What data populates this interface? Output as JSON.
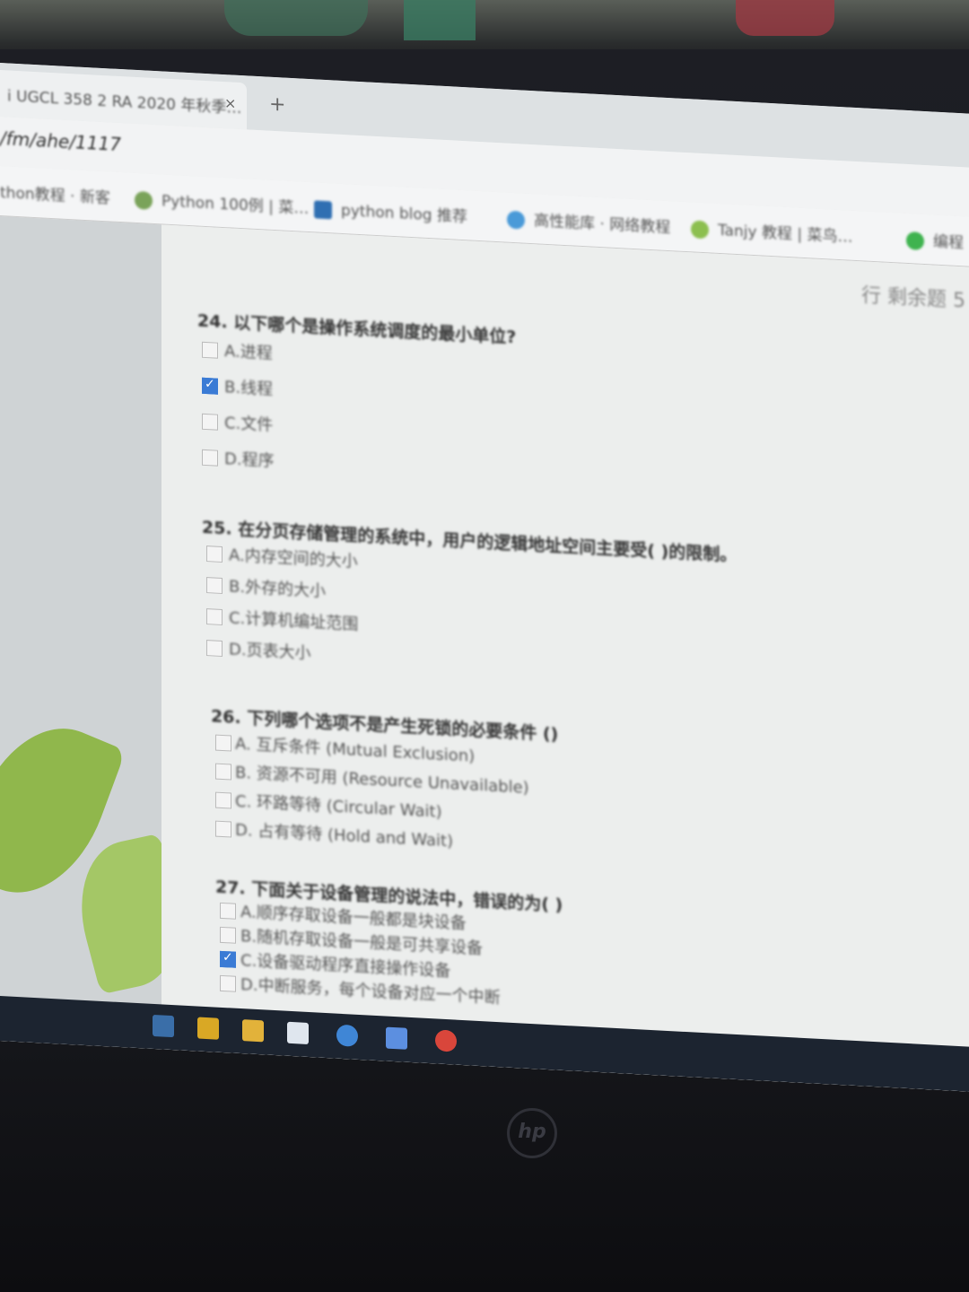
{
  "browser": {
    "tab_title": "i UGCL 358 2 RA 2020 年秋季…",
    "tab_close": "×",
    "new_tab": "+",
    "address": "/fm/ahe/1117",
    "bookmarks": [
      "thon教程 · 新客",
      "Python 100例 | 菜…",
      "python blog 推荐",
      "高性能库 · 网络教程",
      "Tanjy 教程 | 菜鸟…",
      "编程"
    ]
  },
  "page": {
    "tag": "行 剩余题 5"
  },
  "questions": [
    {
      "title": "24. 以下哪个是操作系统调度的最小单位?",
      "options": [
        {
          "label": "A.进程",
          "checked": false
        },
        {
          "label": "B.线程",
          "checked": true
        },
        {
          "label": "C.文件",
          "checked": false
        },
        {
          "label": "D.程序",
          "checked": false
        }
      ]
    },
    {
      "title": "25. 在分页存储管理的系统中，用户的逻辑地址空间主要受( )的限制。",
      "options": [
        {
          "label": "A.内存空间的大小",
          "checked": false
        },
        {
          "label": "B.外存的大小",
          "checked": false
        },
        {
          "label": "C.计算机编址范围",
          "checked": false
        },
        {
          "label": "D.页表大小",
          "checked": false
        }
      ]
    },
    {
      "title": "26. 下列哪个选项不是产生死锁的必要条件 ()",
      "options": [
        {
          "label": "A. 互斥条件 (Mutual Exclusion)",
          "checked": false
        },
        {
          "label": "B. 资源不可用 (Resource Unavailable)",
          "checked": false
        },
        {
          "label": "C. 环路等待 (Circular Wait)",
          "checked": false
        },
        {
          "label": "D. 占有等待 (Hold and Wait)",
          "checked": false
        }
      ]
    },
    {
      "title": "27. 下面关于设备管理的说法中，错误的为( )",
      "options": [
        {
          "label": "A.顺序存取设备一般都是块设备",
          "checked": false
        },
        {
          "label": "B.随机存取设备一般是可共享设备",
          "checked": false
        },
        {
          "label": "C.设备驱动程序直接操作设备",
          "checked": true
        },
        {
          "label": "D.中断服务，每个设备对应一个中断",
          "checked": false
        }
      ]
    }
  ],
  "logo": "hp"
}
